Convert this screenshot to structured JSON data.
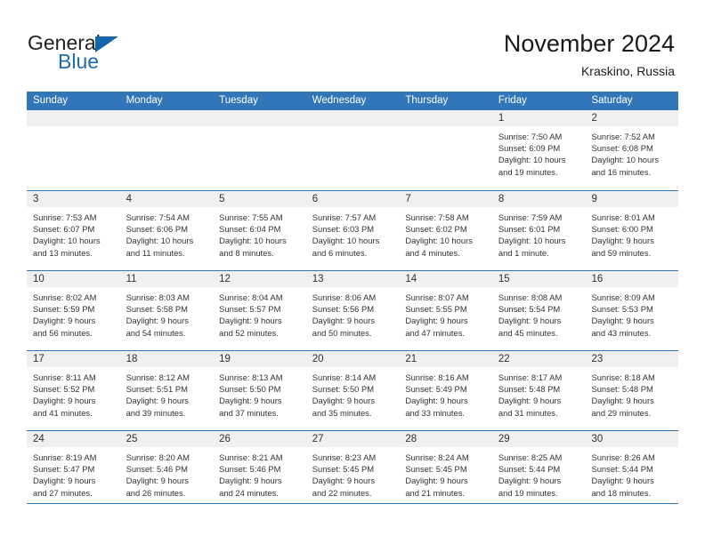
{
  "brand": {
    "name_part1": "General",
    "name_part2": "Blue",
    "triangle_color": "#1166ab",
    "blue_color": "#1f6bb0"
  },
  "header": {
    "title": "November 2024",
    "subtitle": "Kraskino, Russia"
  },
  "theme": {
    "header_row_bg": "#3076b8",
    "daynum_bg": "#f0f0f0",
    "rule_color": "#3076b8",
    "text_color": "#333333"
  },
  "calendar": {
    "day_headers": [
      "Sunday",
      "Monday",
      "Tuesday",
      "Wednesday",
      "Thursday",
      "Friday",
      "Saturday"
    ],
    "labels": {
      "sunrise": "Sunrise:",
      "sunset": "Sunset:",
      "daylight": "Daylight:"
    },
    "weeks": [
      [
        {
          "day": ""
        },
        {
          "day": ""
        },
        {
          "day": ""
        },
        {
          "day": ""
        },
        {
          "day": ""
        },
        {
          "day": "1",
          "sunrise": "Sunrise: 7:50 AM",
          "sunset": "Sunset: 6:09 PM",
          "daylight_line1": "Daylight: 10 hours",
          "daylight_line2": "and 19 minutes."
        },
        {
          "day": "2",
          "sunrise": "Sunrise: 7:52 AM",
          "sunset": "Sunset: 6:08 PM",
          "daylight_line1": "Daylight: 10 hours",
          "daylight_line2": "and 16 minutes."
        }
      ],
      [
        {
          "day": "3",
          "sunrise": "Sunrise: 7:53 AM",
          "sunset": "Sunset: 6:07 PM",
          "daylight_line1": "Daylight: 10 hours",
          "daylight_line2": "and 13 minutes."
        },
        {
          "day": "4",
          "sunrise": "Sunrise: 7:54 AM",
          "sunset": "Sunset: 6:06 PM",
          "daylight_line1": "Daylight: 10 hours",
          "daylight_line2": "and 11 minutes."
        },
        {
          "day": "5",
          "sunrise": "Sunrise: 7:55 AM",
          "sunset": "Sunset: 6:04 PM",
          "daylight_line1": "Daylight: 10 hours",
          "daylight_line2": "and 8 minutes."
        },
        {
          "day": "6",
          "sunrise": "Sunrise: 7:57 AM",
          "sunset": "Sunset: 6:03 PM",
          "daylight_line1": "Daylight: 10 hours",
          "daylight_line2": "and 6 minutes."
        },
        {
          "day": "7",
          "sunrise": "Sunrise: 7:58 AM",
          "sunset": "Sunset: 6:02 PM",
          "daylight_line1": "Daylight: 10 hours",
          "daylight_line2": "and 4 minutes."
        },
        {
          "day": "8",
          "sunrise": "Sunrise: 7:59 AM",
          "sunset": "Sunset: 6:01 PM",
          "daylight_line1": "Daylight: 10 hours",
          "daylight_line2": "and 1 minute."
        },
        {
          "day": "9",
          "sunrise": "Sunrise: 8:01 AM",
          "sunset": "Sunset: 6:00 PM",
          "daylight_line1": "Daylight: 9 hours",
          "daylight_line2": "and 59 minutes."
        }
      ],
      [
        {
          "day": "10",
          "sunrise": "Sunrise: 8:02 AM",
          "sunset": "Sunset: 5:59 PM",
          "daylight_line1": "Daylight: 9 hours",
          "daylight_line2": "and 56 minutes."
        },
        {
          "day": "11",
          "sunrise": "Sunrise: 8:03 AM",
          "sunset": "Sunset: 5:58 PM",
          "daylight_line1": "Daylight: 9 hours",
          "daylight_line2": "and 54 minutes."
        },
        {
          "day": "12",
          "sunrise": "Sunrise: 8:04 AM",
          "sunset": "Sunset: 5:57 PM",
          "daylight_line1": "Daylight: 9 hours",
          "daylight_line2": "and 52 minutes."
        },
        {
          "day": "13",
          "sunrise": "Sunrise: 8:06 AM",
          "sunset": "Sunset: 5:56 PM",
          "daylight_line1": "Daylight: 9 hours",
          "daylight_line2": "and 50 minutes."
        },
        {
          "day": "14",
          "sunrise": "Sunrise: 8:07 AM",
          "sunset": "Sunset: 5:55 PM",
          "daylight_line1": "Daylight: 9 hours",
          "daylight_line2": "and 47 minutes."
        },
        {
          "day": "15",
          "sunrise": "Sunrise: 8:08 AM",
          "sunset": "Sunset: 5:54 PM",
          "daylight_line1": "Daylight: 9 hours",
          "daylight_line2": "and 45 minutes."
        },
        {
          "day": "16",
          "sunrise": "Sunrise: 8:09 AM",
          "sunset": "Sunset: 5:53 PM",
          "daylight_line1": "Daylight: 9 hours",
          "daylight_line2": "and 43 minutes."
        }
      ],
      [
        {
          "day": "17",
          "sunrise": "Sunrise: 8:11 AM",
          "sunset": "Sunset: 5:52 PM",
          "daylight_line1": "Daylight: 9 hours",
          "daylight_line2": "and 41 minutes."
        },
        {
          "day": "18",
          "sunrise": "Sunrise: 8:12 AM",
          "sunset": "Sunset: 5:51 PM",
          "daylight_line1": "Daylight: 9 hours",
          "daylight_line2": "and 39 minutes."
        },
        {
          "day": "19",
          "sunrise": "Sunrise: 8:13 AM",
          "sunset": "Sunset: 5:50 PM",
          "daylight_line1": "Daylight: 9 hours",
          "daylight_line2": "and 37 minutes."
        },
        {
          "day": "20",
          "sunrise": "Sunrise: 8:14 AM",
          "sunset": "Sunset: 5:50 PM",
          "daylight_line1": "Daylight: 9 hours",
          "daylight_line2": "and 35 minutes."
        },
        {
          "day": "21",
          "sunrise": "Sunrise: 8:16 AM",
          "sunset": "Sunset: 5:49 PM",
          "daylight_line1": "Daylight: 9 hours",
          "daylight_line2": "and 33 minutes."
        },
        {
          "day": "22",
          "sunrise": "Sunrise: 8:17 AM",
          "sunset": "Sunset: 5:48 PM",
          "daylight_line1": "Daylight: 9 hours",
          "daylight_line2": "and 31 minutes."
        },
        {
          "day": "23",
          "sunrise": "Sunrise: 8:18 AM",
          "sunset": "Sunset: 5:48 PM",
          "daylight_line1": "Daylight: 9 hours",
          "daylight_line2": "and 29 minutes."
        }
      ],
      [
        {
          "day": "24",
          "sunrise": "Sunrise: 8:19 AM",
          "sunset": "Sunset: 5:47 PM",
          "daylight_line1": "Daylight: 9 hours",
          "daylight_line2": "and 27 minutes."
        },
        {
          "day": "25",
          "sunrise": "Sunrise: 8:20 AM",
          "sunset": "Sunset: 5:46 PM",
          "daylight_line1": "Daylight: 9 hours",
          "daylight_line2": "and 26 minutes."
        },
        {
          "day": "26",
          "sunrise": "Sunrise: 8:21 AM",
          "sunset": "Sunset: 5:46 PM",
          "daylight_line1": "Daylight: 9 hours",
          "daylight_line2": "and 24 minutes."
        },
        {
          "day": "27",
          "sunrise": "Sunrise: 8:23 AM",
          "sunset": "Sunset: 5:45 PM",
          "daylight_line1": "Daylight: 9 hours",
          "daylight_line2": "and 22 minutes."
        },
        {
          "day": "28",
          "sunrise": "Sunrise: 8:24 AM",
          "sunset": "Sunset: 5:45 PM",
          "daylight_line1": "Daylight: 9 hours",
          "daylight_line2": "and 21 minutes."
        },
        {
          "day": "29",
          "sunrise": "Sunrise: 8:25 AM",
          "sunset": "Sunset: 5:44 PM",
          "daylight_line1": "Daylight: 9 hours",
          "daylight_line2": "and 19 minutes."
        },
        {
          "day": "30",
          "sunrise": "Sunrise: 8:26 AM",
          "sunset": "Sunset: 5:44 PM",
          "daylight_line1": "Daylight: 9 hours",
          "daylight_line2": "and 18 minutes."
        }
      ]
    ]
  }
}
